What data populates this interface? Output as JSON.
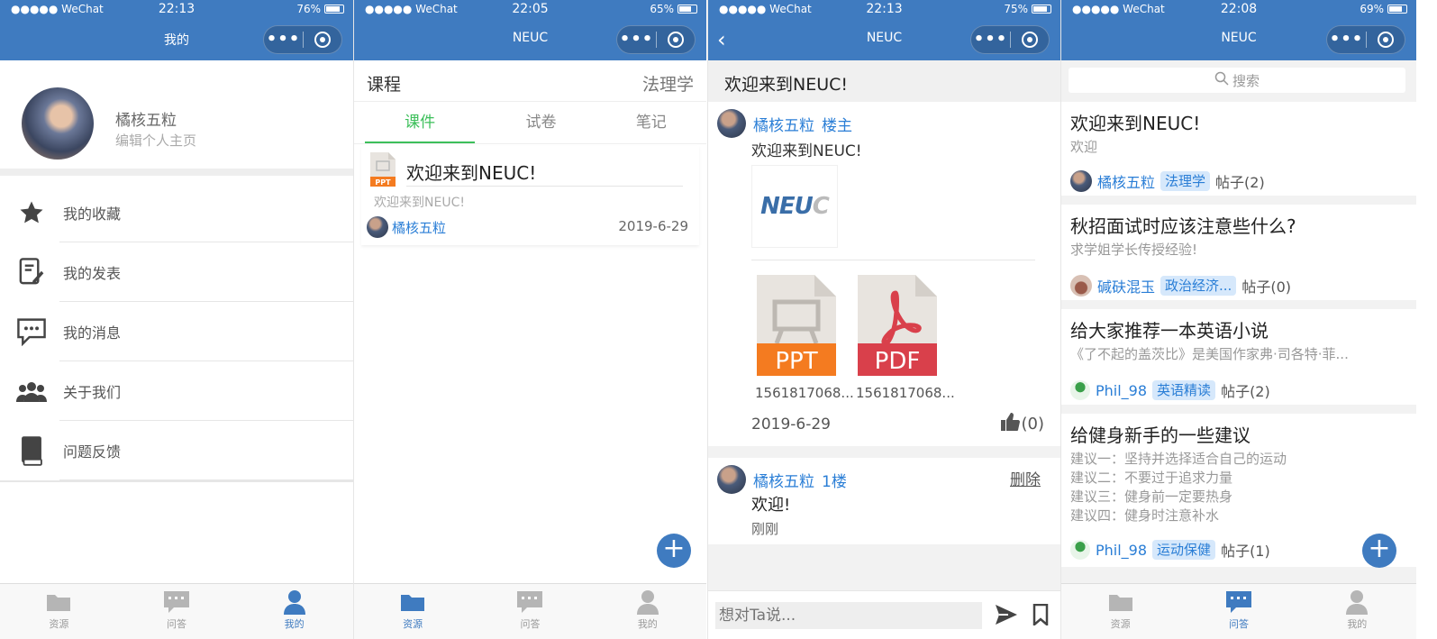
{
  "colors": {
    "brand": "#3f7bc0",
    "link": "#2a7ed6",
    "active_tab": "#3cbf5a"
  },
  "screens": [
    {
      "status": {
        "carrier": "●●●●● WeChat",
        "time": "22:13",
        "battery": "76%",
        "battery_level": 0.76
      },
      "nav_title": "我的",
      "profile": {
        "name": "橘核五粒",
        "edit": "编辑个人主页"
      },
      "menu": [
        {
          "label": "我的收藏",
          "icon": "star-icon"
        },
        {
          "label": "我的发表",
          "icon": "edit-doc-icon"
        },
        {
          "label": "我的消息",
          "icon": "message-icon"
        },
        {
          "label": "关于我们",
          "icon": "group-icon"
        },
        {
          "label": "问题反馈",
          "icon": "book-icon"
        }
      ],
      "tabs": [
        "资源",
        "问答",
        "我的"
      ],
      "active_tab": 2
    },
    {
      "status": {
        "carrier": "●●●●● WeChat",
        "time": "22:05",
        "battery": "65%",
        "battery_level": 0.65
      },
      "nav_title": "NEUC",
      "course": {
        "label": "课程",
        "value": "法理学"
      },
      "subtabs": [
        "课件",
        "试卷",
        "笔记"
      ],
      "card": {
        "title": "欢迎来到NEUC!",
        "desc": "欢迎来到NEUC!",
        "author": "橘核五粒",
        "date": "2019-6-29",
        "icon_text": "PPT"
      },
      "fab": "+",
      "tabs": [
        "资源",
        "问答",
        "我的"
      ],
      "active_tab": 0
    },
    {
      "status": {
        "carrier": "●●●●● WeChat",
        "time": "22:13",
        "battery": "75%",
        "battery_level": 0.75
      },
      "nav_title": "NEUC",
      "back": "‹",
      "header": "欢迎来到NEUC!",
      "post": {
        "author": "橘核五粒",
        "role": "楼主",
        "text": "欢迎来到NEUC!",
        "image_text": "NEU",
        "image_text_c": "C",
        "files": [
          {
            "type": "PPT",
            "name": "1561817068...",
            "color": "#f47b20"
          },
          {
            "type": "PDF",
            "name": "1561817068...",
            "color": "#d9404b"
          }
        ],
        "date": "2019-6-29",
        "likes": "(0)"
      },
      "reply": {
        "author": "橘核五粒",
        "floor": "1楼",
        "delete": "删除",
        "text": "欢迎!",
        "time": "刚刚"
      },
      "input_placeholder": "想对Ta说..."
    },
    {
      "status": {
        "carrier": "●●●●● WeChat",
        "time": "22:08",
        "battery": "69%",
        "battery_level": 0.69
      },
      "nav_title": "NEUC",
      "search_placeholder": "搜索",
      "questions": [
        {
          "title": "欢迎来到NEUC!",
          "desc": [
            "欢迎"
          ],
          "author": "橘核五粒",
          "tag": "法理学",
          "count": "帖子(2)"
        },
        {
          "title": "秋招面试时应该注意些什么?",
          "desc": [
            "求学姐学长传授经验!"
          ],
          "author": "碱砆混玉",
          "tag": "政治经济...",
          "count": "帖子(0)"
        },
        {
          "title": "给大家推荐一本英语小说",
          "desc": [
            "《了不起的盖茨比》是美国作家弗·司各特·菲..."
          ],
          "author": "Phil_98",
          "tag": "英语精读",
          "count": "帖子(2)"
        },
        {
          "title": "给健身新手的一些建议",
          "desc": [
            "建议一：坚持并选择适合自己的运动",
            "建议二：不要过于追求力量",
            "建议三：健身前一定要热身",
            "建议四：健身时注意补水"
          ],
          "author": "Phil_98",
          "tag": "运动保健",
          "count": "帖子(1)"
        }
      ],
      "fab": "+",
      "tabs": [
        "资源",
        "问答",
        "我的"
      ],
      "active_tab": 1
    }
  ]
}
